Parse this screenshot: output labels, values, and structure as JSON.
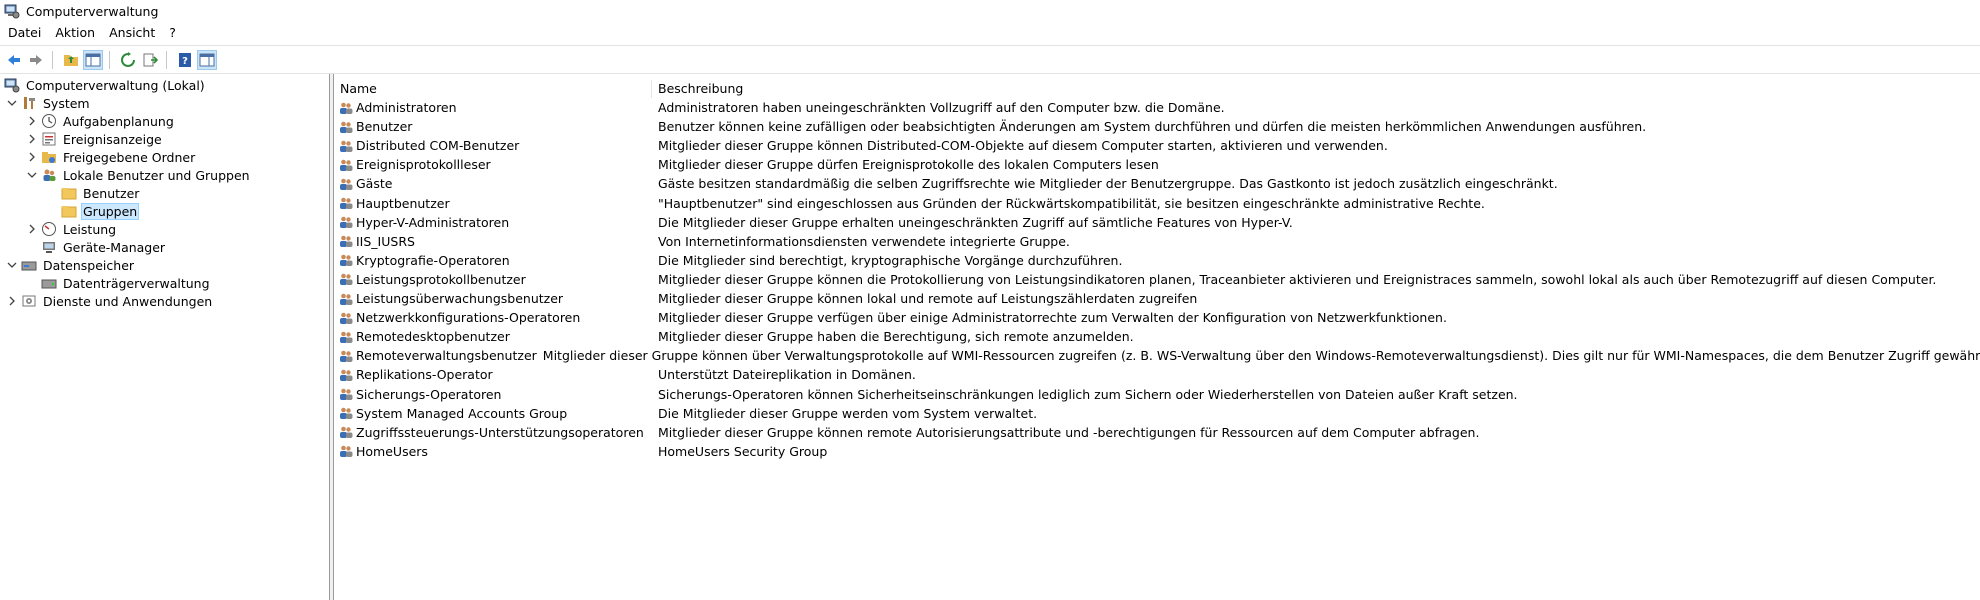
{
  "window": {
    "title": "Computerverwaltung"
  },
  "menu": {
    "items": [
      "Datei",
      "Aktion",
      "Ansicht",
      "?"
    ]
  },
  "toolbar": {
    "buttons": [
      "back-icon",
      "forward-icon",
      "up-folder-icon",
      "show-hide-tree-icon",
      "refresh-icon",
      "export-list-icon",
      "help-icon",
      "show-hide-action-pane-icon"
    ]
  },
  "tree": {
    "root": "Computerverwaltung (Lokal)",
    "system": "System",
    "aufgabenplanung": "Aufgabenplanung",
    "ereignisanzeige": "Ereignisanzeige",
    "freigegebene_ordner": "Freigegebene Ordner",
    "lokale_benutzer": "Lokale Benutzer und Gruppen",
    "benutzer": "Benutzer",
    "gruppen": "Gruppen",
    "leistung": "Leistung",
    "geraete_manager": "Geräte-Manager",
    "datenspeicher": "Datenspeicher",
    "datentraegerverwaltung": "Datenträgerverwaltung",
    "dienste": "Dienste und Anwendungen"
  },
  "list": {
    "columns": {
      "name": "Name",
      "description": "Beschreibung"
    },
    "rows": [
      {
        "name": "Administratoren",
        "description": "Administratoren haben uneingeschränkten Vollzugriff auf den Computer bzw. die Domäne."
      },
      {
        "name": "Benutzer",
        "description": "Benutzer können keine zufälligen oder beabsichtigten Änderungen am System durchführen und dürfen die meisten herkömmlichen Anwendungen ausführen."
      },
      {
        "name": "Distributed COM-Benutzer",
        "description": "Mitglieder dieser Gruppe können Distributed-COM-Objekte auf diesem Computer starten, aktivieren und verwenden."
      },
      {
        "name": "Ereignisprotokollleser",
        "description": "Mitglieder dieser Gruppe dürfen Ereignisprotokolle des lokalen Computers lesen"
      },
      {
        "name": "Gäste",
        "description": "Gäste besitzen standardmäßig die selben Zugriffsrechte wie Mitglieder der Benutzergruppe. Das Gastkonto ist jedoch zusätzlich eingeschränkt."
      },
      {
        "name": "Hauptbenutzer",
        "description": "\"Hauptbenutzer\" sind eingeschlossen aus Gründen der Rückwärtskompatibilität, sie besitzen eingeschränkte administrative Rechte."
      },
      {
        "name": "Hyper-V-Administratoren",
        "description": "Die Mitglieder dieser Gruppe erhalten uneingeschränkten Zugriff auf sämtliche Features von Hyper-V."
      },
      {
        "name": "IIS_IUSRS",
        "description": "Von Internetinformationsdiensten verwendete integrierte Gruppe."
      },
      {
        "name": "Kryptografie-Operatoren",
        "description": "Die Mitglieder sind berechtigt, kryptographische Vorgänge durchzuführen."
      },
      {
        "name": "Leistungsprotokollbenutzer",
        "description": "Mitglieder dieser Gruppe können die Protokollierung von Leistungsindikatoren planen, Traceanbieter aktivieren und Ereignistraces sammeln, sowohl lokal als auch über Remotezugriff auf diesen Computer."
      },
      {
        "name": "Leistungsüberwachungsbenutzer",
        "description": "Mitglieder dieser Gruppe können lokal und remote auf Leistungszählerdaten zugreifen"
      },
      {
        "name": "Netzwerkkonfigurations-Operatoren",
        "description": "Mitglieder dieser Gruppe verfügen über einige Administratorrechte zum Verwalten der Konfiguration von Netzwerkfunktionen."
      },
      {
        "name": "Remotedesktopbenutzer",
        "description": "Mitglieder dieser Gruppe haben die Berechtigung, sich remote anzumelden."
      },
      {
        "name": "Remoteverwaltungsbenutzer",
        "description": "Mitglieder dieser Gruppe können über Verwaltungsprotokolle auf WMI-Ressourcen zugreifen (z. B. WS-Verwaltung über den Windows-Remoteverwaltungsdienst). Dies gilt nur für WMI-Namespaces, die dem Benutzer Zugriff gewähren."
      },
      {
        "name": "Replikations-Operator",
        "description": "Unterstützt Dateireplikation in Domänen."
      },
      {
        "name": "Sicherungs-Operatoren",
        "description": "Sicherungs-Operatoren können Sicherheitseinschränkungen lediglich zum Sichern oder Wiederherstellen von Dateien außer Kraft setzen."
      },
      {
        "name": "System Managed Accounts Group",
        "description": "Die Mitglieder dieser Gruppe werden vom System verwaltet."
      },
      {
        "name": "Zugriffssteuerungs-Unterstützungsoperatoren",
        "description": "Mitglieder dieser Gruppe können remote Autorisierungsattribute und -berechtigungen für Ressourcen auf dem Computer abfragen."
      },
      {
        "name": "HomeUsers",
        "description": "HomeUsers Security Group"
      }
    ]
  },
  "colors": {
    "selection": "#cce8ff",
    "accent": "#0078d7",
    "folder": "#f2c75c"
  }
}
